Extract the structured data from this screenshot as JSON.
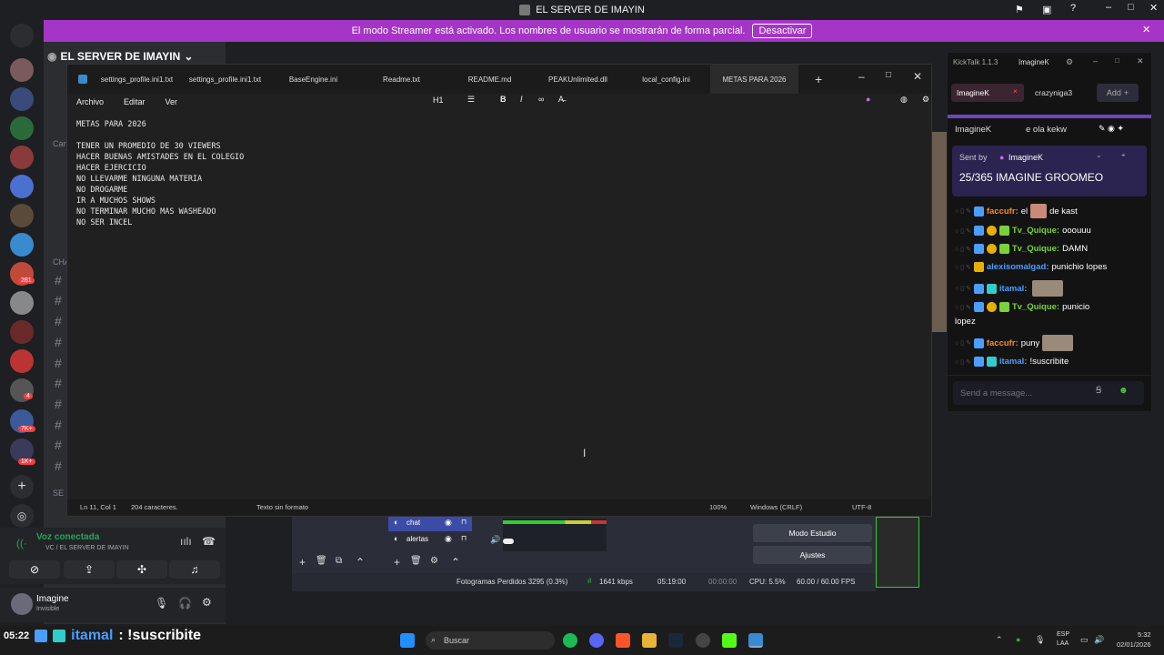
{
  "window_title": "EL SERVER DE IMAYIN",
  "streamer_banner": {
    "text": "El modo Streamer está activado. Los nombres de usuario se mostrarán de forma parcial.",
    "button": "Desactivar"
  },
  "discord": {
    "server_name": "EL SERVER DE IMAYIN",
    "channel_hashes": [
      "#",
      "#",
      "#",
      "#",
      "#",
      "#",
      "#",
      "#",
      "#",
      "#"
    ],
    "partial_labels": {
      "cam": "Cam",
      "cha": "CHA",
      "se": "SE"
    },
    "voice_status": "Voz conectada",
    "voice_channel": "VC / EL SERVER DE IMAYIN",
    "username": "Imagine",
    "user_status": "Invisible",
    "badges": {
      "b1": "281",
      "b2": "4",
      "b3": "7K+",
      "b4": "1K+"
    }
  },
  "notepad": {
    "tabs": [
      "settings_profile.ini1.txt",
      "settings_profile.ini1.txt",
      "BaseEngine.ini",
      "Readme.txt",
      "README.md",
      "PEAKUnlimited.dll",
      "local_config.ini",
      "METAS PARA 2026"
    ],
    "active_tab": "METAS PARA 2026",
    "menu": [
      "Archivo",
      "Editar",
      "Ver"
    ],
    "heading_btn": "H1",
    "content": "METAS PARA 2026\n\nTENER UN PROMEDIO DE 30 VIEWERS\nHACER BUENAS AMISTADES EN EL COLEGIO\nHACER EJERCICIO\nNO LLEVARME NINGUNA MATERIA\nNO DROGARME\nIR A MUCHOS SHOWS\nNO TERMINAR MUCHO MAS WASHEADO\nNO SER INCEL",
    "status": {
      "position": "Ln 11, Col 1",
      "chars": "204 caracteres.",
      "format": "Texto sin formato",
      "zoom": "100%",
      "eol": "Windows (CRLF)",
      "encoding": "UTF-8"
    }
  },
  "obs": {
    "sources": [
      "chat",
      "alertas"
    ],
    "buttons": [
      "Modo Estudio",
      "Ajustes"
    ],
    "stats": {
      "dropped": "Fotogramas Perdidos 3295 (0.3%)",
      "bitrate": "1641 kbps",
      "time": "05:19:00",
      "rec": "00:00:00",
      "cpu": "CPU: 5.5%",
      "fps": "60.00 / 60.00 FPS"
    }
  },
  "kicktalk": {
    "title": "KickTalk 1.1.3",
    "tab_user": "ImagineK",
    "chat_tabs": [
      "ImagineK",
      "crazyniga3"
    ],
    "add_label": "Add",
    "pinned_user": "ImagineK",
    "pinned_text": "e ola kekw",
    "sent_by_label": "Sent by",
    "sent_by_user": "ImagineK",
    "announcement": "25/365 IMAGINE GROOMEO",
    "messages": [
      {
        "user": "faccufr:",
        "text": "el",
        "text2": "de kast",
        "color": "#ff8c1a"
      },
      {
        "user": "Tv_Quique:",
        "text": "ooouuu",
        "color": "#7bd13a"
      },
      {
        "user": "Tv_Quique:",
        "text": "DAMN",
        "color": "#7bd13a"
      },
      {
        "user": "alexisomalgad:",
        "text": "punichio lopes",
        "color": "#4a9eff"
      },
      {
        "user": "itamal:",
        "text": "",
        "color": "#4a9eff"
      },
      {
        "user": "Tv_Quique:",
        "text": "punicio",
        "text2": "lopez",
        "color": "#7bd13a"
      },
      {
        "user": "faccufr:",
        "text": "puny",
        "color": "#ff8c1a"
      },
      {
        "user": "itamal:",
        "text": "!suscribite",
        "color": "#4a9eff"
      }
    ],
    "input_placeholder": "Send a message..."
  },
  "ticker": {
    "time": "05:22",
    "user": "itamal",
    "text": ": !suscribite"
  },
  "taskbar": {
    "search": "Buscar",
    "lang": "ESP",
    "lang2": "LAA",
    "clock": "5:32",
    "date": "02/01/2026"
  }
}
